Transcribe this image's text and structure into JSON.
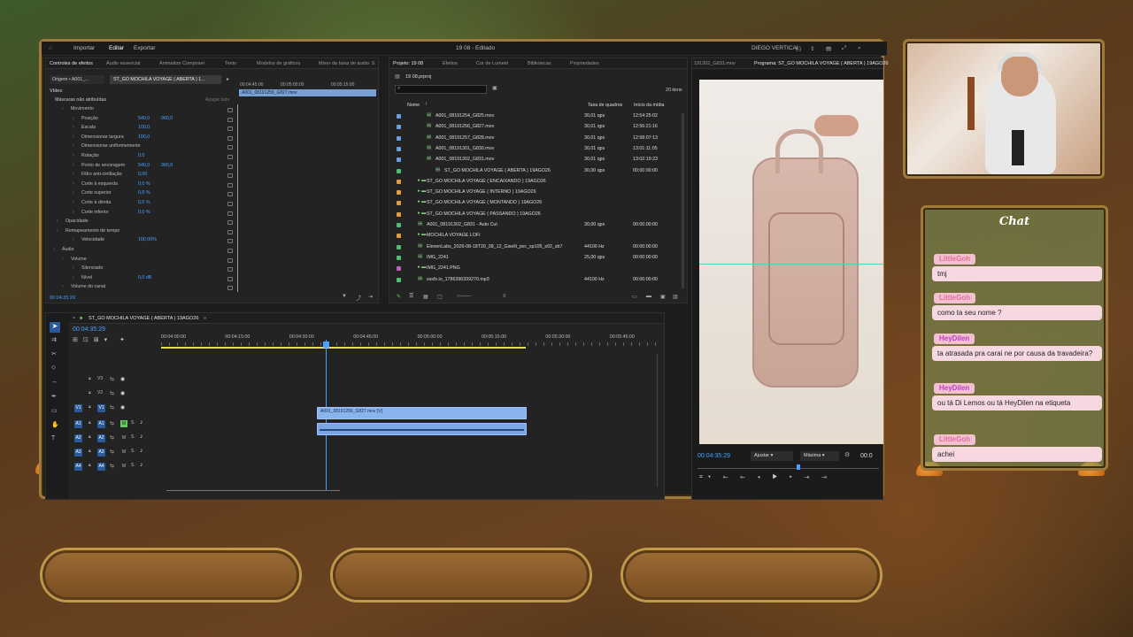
{
  "menubar": {
    "items": [
      "Importar",
      "Editar",
      "Exportar"
    ],
    "title": "19 08 - Editado",
    "workspace": "DIEGO VERTICAL"
  },
  "effect_controls": {
    "tabs": [
      "Controles de efeitos",
      "Áudio essencial",
      "Animation Composer",
      "Texto",
      "Modelos de gráficos",
      "Mixer da faixa de áudio: S"
    ],
    "source_dropdown": "Origem • A001_...",
    "clip_dropdown": "ST_GO MOCHILA VOYAGE ( ABERTA ) 1...",
    "clip_bar": "A001_08191256_G827.mov",
    "ruler": [
      "00:04:45:00",
      "00:05:00:00",
      "00:05:15:00"
    ],
    "section_video": "Vídeo",
    "masks": "Máscaras não atribuídas",
    "masks_btn": "Apagar tudo",
    "rows": [
      {
        "label": "Movimento",
        "v1": "",
        "v2": ""
      },
      {
        "label": "Posição",
        "v1": "540,0",
        "v2": "960,0"
      },
      {
        "label": "Escala",
        "v1": "100,0",
        "v2": ""
      },
      {
        "label": "Dimensionar largura",
        "v1": "100,0",
        "v2": ""
      },
      {
        "label": "Dimensionar uniformemente",
        "v1": "",
        "v2": ""
      },
      {
        "label": "Rotação",
        "v1": "0,0",
        "v2": ""
      },
      {
        "label": "Ponto de ancoragem",
        "v1": "540,0",
        "v2": "960,0"
      },
      {
        "label": "Filtro anti-cintilação",
        "v1": "0,00",
        "v2": ""
      },
      {
        "label": "Corte à esquerda",
        "v1": "0,0 %",
        "v2": ""
      },
      {
        "label": "Corte superior",
        "v1": "0,0 %",
        "v2": ""
      },
      {
        "label": "Corte à direita",
        "v1": "0,0 %",
        "v2": ""
      },
      {
        "label": "Corte inferior",
        "v1": "0,0 %",
        "v2": ""
      },
      {
        "label": "Opacidade",
        "v1": "",
        "v2": ""
      },
      {
        "label": "Remapeamento de tempo",
        "v1": "",
        "v2": ""
      },
      {
        "label": "Velocidade",
        "v1": "100,00%",
        "v2": ""
      },
      {
        "label": "Áudio",
        "v1": "",
        "v2": ""
      },
      {
        "label": "Volume",
        "v1": "",
        "v2": ""
      },
      {
        "label": "Silenciado",
        "v1": "",
        "v2": ""
      },
      {
        "label": "Nível",
        "v1": "0,0 dB",
        "v2": ""
      },
      {
        "label": "Volume do canal",
        "v1": "",
        "v2": ""
      }
    ],
    "timecode": "00:04:35:29"
  },
  "project": {
    "tabs": [
      "Projeto: 19 08",
      "Efeitos",
      "Cor de Lumetri",
      "Bibliotecas",
      "Propriedades"
    ],
    "file": "19 08.prproj",
    "count": "20 itens",
    "headers": [
      "Nome",
      "Taxa de quadros",
      "Início da mídia"
    ],
    "items": [
      {
        "name": "A001_08191254_G825.mov",
        "rate": "30,01 qps",
        "start": "12:54:25:02",
        "color": "#6aa0e0"
      },
      {
        "name": "A001_08191256_G827.mov",
        "rate": "30,01 qps",
        "start": "12:56:21:16",
        "color": "#6aa0e0"
      },
      {
        "name": "A001_08191257_G828.mov",
        "rate": "30,01 qps",
        "start": "12:58:07:13",
        "color": "#6aa0e0"
      },
      {
        "name": "A001_08191301_G830.mov",
        "rate": "30,01 qps",
        "start": "13:01:11:05",
        "color": "#6aa0e0"
      },
      {
        "name": "A001_08191302_G831.mov",
        "rate": "30,01 qps",
        "start": "13:02:19:23",
        "color": "#6aa0e0"
      },
      {
        "name": "ST_GO MOCHILA VOYAGE ( ABERTA ) 19AGO26",
        "rate": "30,00 qps",
        "start": "00:00:00:00",
        "color": "#4ac070"
      },
      {
        "name": "ST_GO MOCHILA VOYAGE ( ENCAIXANDO ) 19AGO26",
        "rate": "",
        "start": "",
        "color": "#e0a040"
      },
      {
        "name": "ST_GO MOCHILA VOYAGE ( INTERNO ) 19AGO26",
        "rate": "",
        "start": "",
        "color": "#e0a040"
      },
      {
        "name": "ST_GO MOCHILA VOYAGE ( MONTANDO ) 19AGO26",
        "rate": "",
        "start": "",
        "color": "#e0a040"
      },
      {
        "name": "ST_GO MOCHILA VOYAGE ( PASSANDO ) 19AGO26",
        "rate": "",
        "start": "",
        "color": "#e0a040"
      },
      {
        "name": "A001_08191302_G831 - Auto Cut",
        "rate": "30,00 qps",
        "start": "00:00:00:00",
        "color": "#4ac070"
      },
      {
        "name": "MOCHILA VOYAGE LOFI",
        "rate": "",
        "start": "",
        "color": "#e0a040"
      },
      {
        "name": "ElevenLabs_2026-08-18T20_08_12_Giselli_pvc_sp105_s92_sb7",
        "rate": "44100 Hz",
        "start": "00:00:00:00",
        "color": "#4ac070"
      },
      {
        "name": "IMG_2241",
        "rate": "25,00 qps",
        "start": "00:00:00:00",
        "color": "#4ac070"
      },
      {
        "name": "IMG_2241.PNG",
        "rate": "",
        "start": "",
        "color": "#c060c0"
      },
      {
        "name": "sssfx.io_1786396339270.mp3",
        "rate": "44100 Hz",
        "start": "00:00:00:00",
        "color": "#4ac070"
      }
    ]
  },
  "program": {
    "source_label": "191302_G831.mov",
    "title": "Programa: ST_GO MOCHILA VOYAGE ( ABERTA ) 19AGO26",
    "timecode": "00:04:35:29",
    "fit": "Ajustar",
    "quality": "Máxima",
    "duration": "00:0"
  },
  "timeline": {
    "tab": "ST_GO MOCHILA VOYAGE ( ABERTA ) 19AGO26",
    "timecode": "00:04:35:29",
    "ruler": [
      "00:04:00:00",
      "00:04:15:00",
      "00:04:30:00",
      "00:04:45:00",
      "00:05:00:00",
      "00:05:15:00",
      "00:05:30:00",
      "00:05:45:00"
    ],
    "tracks": [
      "V3",
      "V2",
      "V1",
      "A1",
      "A2",
      "A3",
      "A4"
    ],
    "video_clip": "A001_08191256_G827.mov [V]"
  },
  "chat": {
    "title": "Chat",
    "messages": [
      {
        "user": "LittleGoh",
        "text": "tmj",
        "user_color": "#e070a0"
      },
      {
        "user": "LittleGoh",
        "text": "como ta seu nome ?",
        "user_color": "#e070a0"
      },
      {
        "user": "HeyDilen",
        "text": "ta atrasada pra carai ne por causa da travadeira?",
        "user_color": "#c040c0"
      },
      {
        "user": "HeyDilen",
        "text": "ou tá Di Lemos ou tá HeyDilen na etiqueta",
        "user_color": "#c040c0"
      },
      {
        "user": "LittleGoh",
        "text": "achei",
        "user_color": "#e070a0"
      }
    ]
  }
}
